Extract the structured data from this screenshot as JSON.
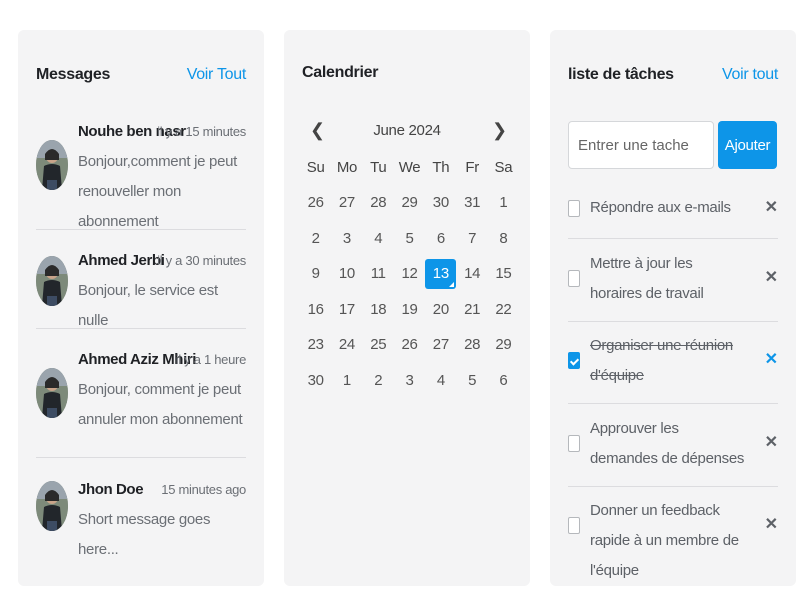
{
  "messages": {
    "title": "Messages",
    "view_all": "Voir Tout",
    "items": [
      {
        "name": "Nouhe ben nasr",
        "time": "il y a 15 minutes",
        "text": "Bonjour,comment je peut renouveller mon abonnement"
      },
      {
        "name": "Ahmed Jerbi",
        "time": "il y a 30 minutes",
        "text": "Bonjour, le service est nulle"
      },
      {
        "name": "Ahmed Aziz Mhiri",
        "time": "il y a 1 heure",
        "text": "Bonjour, comment je peut annuler mon abonnement"
      },
      {
        "name": "Jhon Doe",
        "time": "15 minutes ago",
        "text": "Short message goes here..."
      }
    ]
  },
  "calendar": {
    "title": "Calendrier",
    "month": "June 2024",
    "prev_icon": "chevron-left-icon",
    "next_icon": "chevron-right-icon",
    "weekdays": [
      "Su",
      "Mo",
      "Tu",
      "We",
      "Th",
      "Fr",
      "Sa"
    ],
    "weeks": [
      [
        "26",
        "27",
        "28",
        "29",
        "30",
        "31",
        "1"
      ],
      [
        "2",
        "3",
        "4",
        "5",
        "6",
        "7",
        "8"
      ],
      [
        "9",
        "10",
        "11",
        "12",
        "13",
        "14",
        "15"
      ],
      [
        "16",
        "17",
        "18",
        "19",
        "20",
        "21",
        "22"
      ],
      [
        "23",
        "24",
        "25",
        "26",
        "27",
        "28",
        "29"
      ],
      [
        "30",
        "1",
        "2",
        "3",
        "4",
        "5",
        "6"
      ]
    ],
    "selected_day": "13",
    "accent": "#0d95e8"
  },
  "todo": {
    "title": "liste de tâches",
    "view_all": "Voir tout",
    "input_placeholder": "Entrer une tache",
    "add_label": "Ajouter",
    "delete_icon": "close-icon",
    "items": [
      {
        "text": "Répondre aux e-mails",
        "done": false
      },
      {
        "text": "Mettre à jour les horaires de travail",
        "done": false
      },
      {
        "text": "Organiser une réunion d'équipe",
        "done": true
      },
      {
        "text": "Approuver les demandes de dépenses",
        "done": false
      },
      {
        "text": "Donner un feedback rapide à un membre de l'équipe",
        "done": false
      }
    ]
  }
}
